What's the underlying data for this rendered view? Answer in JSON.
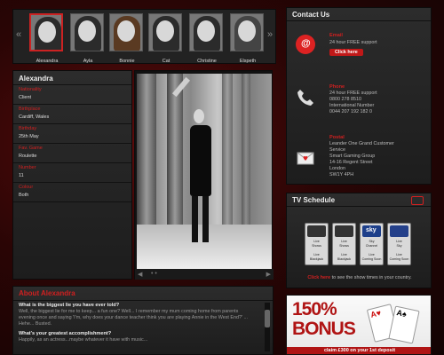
{
  "thumbs": {
    "items": [
      {
        "name": "Alexandra",
        "active": true
      },
      {
        "name": "Ayla"
      },
      {
        "name": "Bonnie"
      },
      {
        "name": "Cat"
      },
      {
        "name": "Christine"
      },
      {
        "name": "Elspeth"
      }
    ]
  },
  "profile": {
    "name": "Alexandra",
    "fields": [
      {
        "label": "Nationality",
        "value": "Client"
      },
      {
        "label": "Birthplace",
        "value": "Cardiff, Wales"
      },
      {
        "label": "Birthday",
        "value": "25th May"
      },
      {
        "label": "Fav. Game",
        "value": "Roulette"
      },
      {
        "label": "Number",
        "value": "11"
      },
      {
        "label": "Colour",
        "value": "Both"
      }
    ]
  },
  "photo": {
    "dots": "• •"
  },
  "about": {
    "title": "About Alexandra",
    "q1": "What is the biggest lie you have ever told?",
    "a1": "Well, the biggest lie for me to keep... a fun one? Well... I remember my mum coming home from parents evening once and saying 'I'm, why does your dance teacher think you are playing Annie in the West End?' ... Hehe... Busted.",
    "q2": "What's your greatest accomplishment?",
    "a2": "Happily, as an actress...maybe whatever it have with music..."
  },
  "contact": {
    "title": "Contact Us",
    "email": {
      "title": "Email",
      "line1": "24 hour FREE support",
      "button": "Click here"
    },
    "phone": {
      "title": "Phone",
      "lines": [
        "24 hour FREE support",
        "0800 278 8510",
        "International Number",
        "0044 207 192 182 0"
      ]
    },
    "postal": {
      "title": "Postal",
      "lines": [
        "Leander One Grand Customer",
        "Service",
        "Smart Gaming Group",
        "14-16 Regent Street",
        "London",
        "SW1Y 4PH"
      ]
    }
  },
  "tv": {
    "title": "TV Schedule",
    "channels": [
      {
        "logo": "",
        "line1": "Live",
        "line2": "Shows",
        "line3": "Live",
        "line4": "Blackjack"
      },
      {
        "logo": "",
        "line1": "Live",
        "line2": "Shows",
        "line3": "Live",
        "line4": "Blackjack"
      },
      {
        "logo": "sky",
        "line1": "Sky",
        "line2": "Channel",
        "line3": "Live",
        "line4": "Coming Soon"
      },
      {
        "logo": "",
        "line1": "Live",
        "line2": "Sky",
        "line3": "Live",
        "line4": "Coming Soon"
      }
    ],
    "caption_link": "Click here",
    "caption_rest": " to see the show times in your country."
  },
  "bonus": {
    "line1": "150%",
    "line2": "BONUS",
    "strip": "claim £300 on your 1st deposit",
    "card1": "A♥",
    "card2": "A♠"
  },
  "colors": {
    "accent": "#d02020",
    "panel": "#232323",
    "background": "#2a0505"
  }
}
